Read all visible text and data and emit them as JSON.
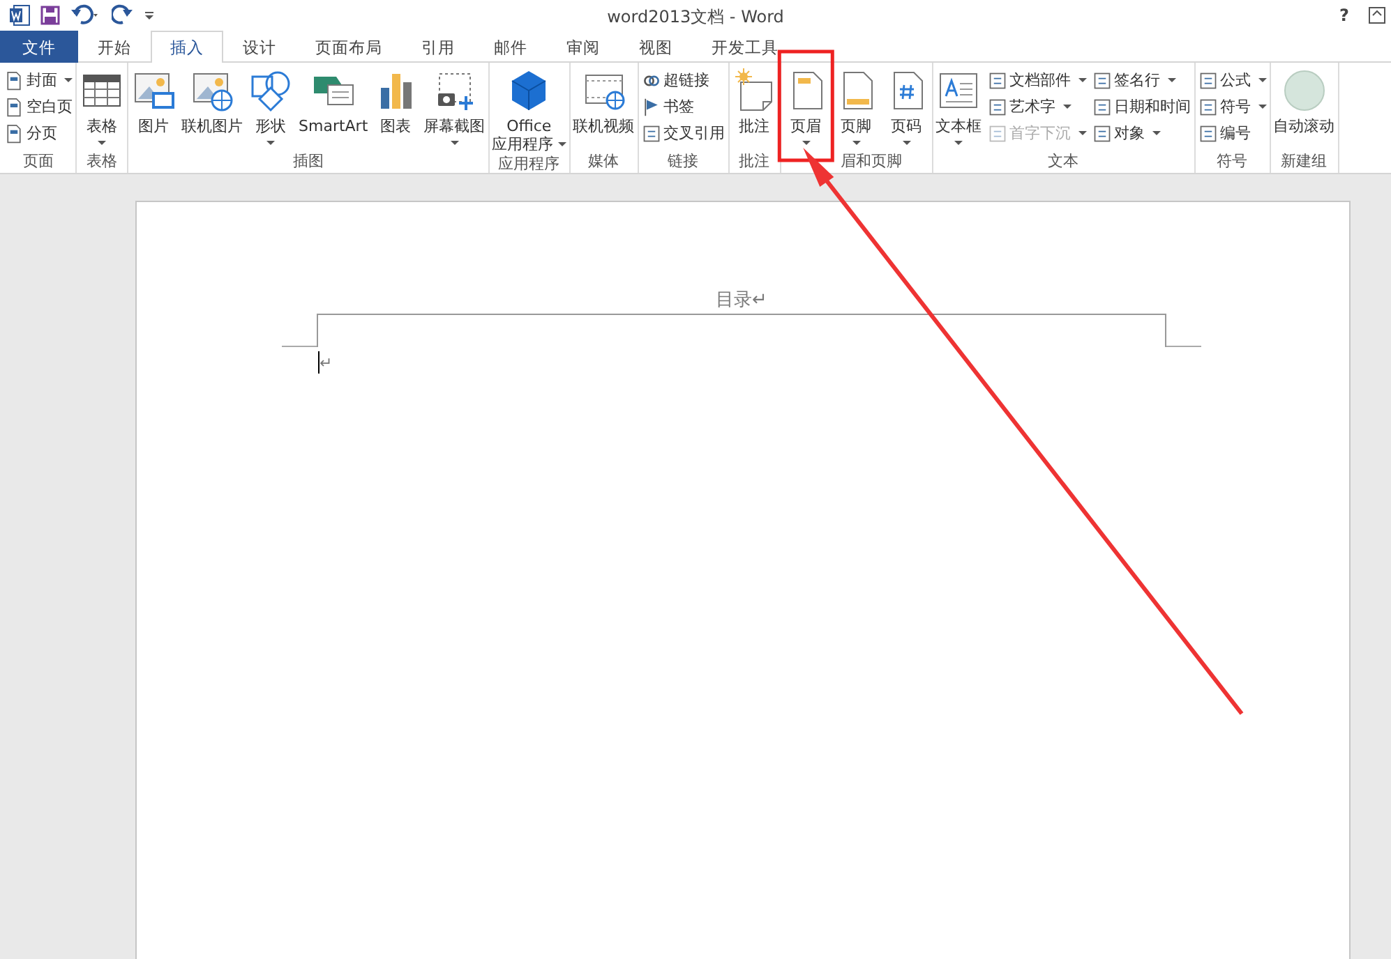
{
  "title_bar": {
    "title": "word2013文档 - Word",
    "help": "?"
  },
  "tabs": [
    {
      "label": "文件",
      "kind": "file",
      "selected": false
    },
    {
      "label": "开始",
      "kind": "tab",
      "selected": false
    },
    {
      "label": "插入",
      "kind": "tab",
      "selected": true
    },
    {
      "label": "设计",
      "kind": "tab",
      "selected": false
    },
    {
      "label": "页面布局",
      "kind": "tab",
      "selected": false
    },
    {
      "label": "引用",
      "kind": "tab",
      "selected": false
    },
    {
      "label": "邮件",
      "kind": "tab",
      "selected": false
    },
    {
      "label": "审阅",
      "kind": "tab",
      "selected": false
    },
    {
      "label": "视图",
      "kind": "tab",
      "selected": false
    },
    {
      "label": "开发工具",
      "kind": "tab",
      "selected": false
    }
  ],
  "ribbon_groups": [
    {
      "label": "页面",
      "items": [
        {
          "kind": "small",
          "label": "封面",
          "dropdown": true
        },
        {
          "kind": "small",
          "label": "空白页",
          "dropdown": false
        },
        {
          "kind": "small",
          "label": "分页",
          "dropdown": false
        }
      ]
    },
    {
      "label": "表格",
      "items": [
        {
          "kind": "large",
          "label": "表格",
          "dropdown": true
        }
      ]
    },
    {
      "label": "插图",
      "items": [
        {
          "kind": "large",
          "label": "图片",
          "dropdown": false
        },
        {
          "kind": "large",
          "label": "联机图片",
          "dropdown": false
        },
        {
          "kind": "large",
          "label": "形状",
          "dropdown": true
        },
        {
          "kind": "large",
          "label": "SmartArt",
          "dropdown": false
        },
        {
          "kind": "large",
          "label": "图表",
          "dropdown": false
        },
        {
          "kind": "large",
          "label": "屏幕截图",
          "dropdown": true
        }
      ]
    },
    {
      "label": "应用程序",
      "items": [
        {
          "kind": "large",
          "label": "Office",
          "label_line2": "应用程序",
          "dropdown": true
        }
      ]
    },
    {
      "label": "媒体",
      "items": [
        {
          "kind": "large",
          "label": "联机视频",
          "dropdown": false
        }
      ]
    },
    {
      "label": "链接",
      "items": [
        {
          "kind": "small",
          "label": "超链接",
          "dropdown": false
        },
        {
          "kind": "small",
          "label": "书签",
          "dropdown": false
        },
        {
          "kind": "small",
          "label": "交叉引用",
          "dropdown": false
        }
      ]
    },
    {
      "label": "批注",
      "items": [
        {
          "kind": "large",
          "label": "批注",
          "dropdown": false
        }
      ]
    },
    {
      "label": "眉和页脚",
      "items": [
        {
          "kind": "large",
          "label": "页眉",
          "dropdown": true,
          "highlighted": true
        },
        {
          "kind": "large",
          "label": "页脚",
          "dropdown": true
        },
        {
          "kind": "large",
          "label": "页码",
          "dropdown": true
        }
      ]
    },
    {
      "label": "文本",
      "items": [
        {
          "kind": "large",
          "label": "文本框",
          "dropdown": true
        },
        {
          "kind": "small",
          "label": "文档部件",
          "dropdown": true
        },
        {
          "kind": "small",
          "label": "艺术字",
          "dropdown": true
        },
        {
          "kind": "small",
          "label": "首字下沉",
          "dropdown": true,
          "disabled": true
        },
        {
          "kind": "small",
          "label": "签名行",
          "dropdown": true
        },
        {
          "kind": "small",
          "label": "日期和时间",
          "dropdown": false
        },
        {
          "kind": "small",
          "label": "对象",
          "dropdown": true
        }
      ]
    },
    {
      "label": "符号",
      "items": [
        {
          "kind": "small",
          "label": "公式",
          "dropdown": true
        },
        {
          "kind": "small",
          "label": "符号",
          "dropdown": true
        },
        {
          "kind": "small",
          "label": "编号",
          "dropdown": false
        }
      ]
    },
    {
      "label": "新建组",
      "items": [
        {
          "kind": "large",
          "label": "自动滚动",
          "dropdown": false
        }
      ]
    }
  ],
  "document": {
    "header_text": "目录↵",
    "body_mark": "↵"
  }
}
